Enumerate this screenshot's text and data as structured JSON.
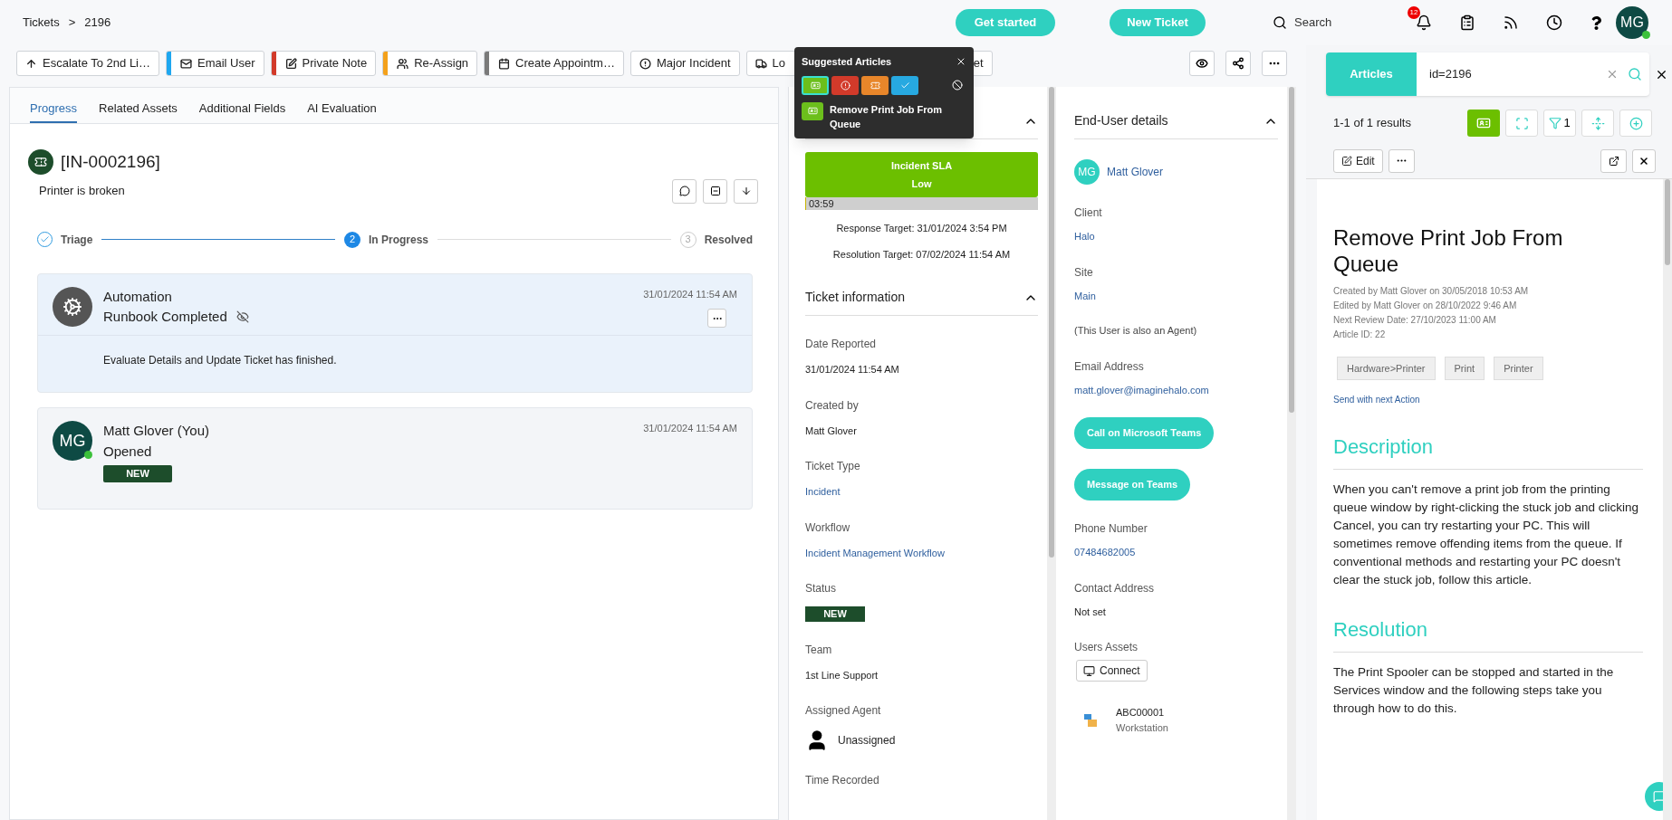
{
  "breadcrumb": {
    "items": [
      "Tickets",
      "2196"
    ],
    "separator": ">"
  },
  "header": {
    "buttons": [
      "Get started",
      "New Ticket"
    ],
    "search": {
      "placeholder": "Search"
    },
    "notification_count": "12",
    "avatar": {
      "initials": "MG",
      "online": true
    }
  },
  "toolbar": [
    {
      "label": "Escalate To 2nd Li…"
    },
    {
      "label": "Email User",
      "color": "#1ea7f0"
    },
    {
      "label": "Private Note",
      "color": "#d23a2a"
    },
    {
      "label": "Re-Assign",
      "color": "#f4a11b"
    },
    {
      "label": "Create Appointm…",
      "color": "#7a7a7a"
    },
    {
      "label": "Major Incident"
    },
    {
      "label": "Lo"
    },
    {
      "label": "et"
    }
  ],
  "suggested_articles": {
    "title": "Suggested Articles",
    "filters": [
      {
        "color": "#6cbf1c",
        "selected": true
      },
      {
        "color": "#d23a2a",
        "selected": false
      },
      {
        "color": "#e8862a",
        "selected": false
      },
      {
        "color": "#27a9e1",
        "selected": false
      }
    ],
    "articles": [
      {
        "title": "Remove Print Job From Queue"
      }
    ]
  },
  "tabs": [
    {
      "label": "Progress",
      "selected": true
    },
    {
      "label": "Related Assets",
      "selected": false
    },
    {
      "label": "Additional Fields",
      "selected": false
    },
    {
      "label": "AI Evaluation",
      "selected": false
    }
  ],
  "ticket": {
    "id": "[IN-0002196]",
    "summary": "Printer is broken"
  },
  "steps": [
    {
      "kind": "done",
      "label": "Triage"
    },
    {
      "kind": "current",
      "number": "2",
      "label": "In Progress"
    },
    {
      "kind": "pending",
      "number": "3",
      "label": "Resolved"
    }
  ],
  "actions": [
    {
      "kind": "automation",
      "author": "Automation",
      "title": "Runbook Completed",
      "hidden": true,
      "time": "31/01/2024 11:54 AM",
      "body": "Evaluate Details and Update Ticket has finished."
    },
    {
      "kind": "user",
      "initials": "MG",
      "online": true,
      "author": "Matt Glover (You)",
      "title": "Opened",
      "hidden": false,
      "time": "31/01/2024 11:54 AM",
      "badge": "NEW"
    }
  ],
  "sla": {
    "name": "Incident SLA",
    "priority": "Low",
    "timer": "03:59",
    "level": 0.005,
    "response_target": "Response Target: 31/01/2024 3:54 PM",
    "resolution_target": "Resolution Target: 07/02/2024 11:54 AM"
  },
  "ticket_info": {
    "title": "Ticket information",
    "fields": [
      {
        "kind": "text",
        "label": "Date Reported",
        "value": "31/01/2024 11:54 AM"
      },
      {
        "kind": "text",
        "label": "Created by",
        "value": "Matt Glover"
      },
      {
        "kind": "link",
        "label": "Ticket Type",
        "value": "Incident"
      },
      {
        "kind": "link",
        "label": "Workflow",
        "value": "Incident Management Workflow"
      },
      {
        "kind": "badge",
        "label": "Status",
        "value": "NEW"
      },
      {
        "kind": "text",
        "label": "Team",
        "value": "1st Line Support"
      },
      {
        "kind": "agent",
        "label": "Assigned Agent",
        "value": "Unassigned"
      },
      {
        "kind": "label",
        "label": "Time Recorded"
      }
    ]
  },
  "end_user": {
    "title": "End-User details",
    "items": [
      {
        "kind": "user",
        "initials": "MG",
        "name": "Matt Glover"
      },
      {
        "kind": "link",
        "label": "Client",
        "value": "Halo"
      },
      {
        "kind": "link",
        "label": "Site",
        "value": "Main"
      },
      {
        "kind": "note",
        "value": "(This User is also an Agent)"
      },
      {
        "kind": "link",
        "label": "Email Address",
        "value": "matt.glover@imaginehalo.com"
      },
      {
        "kind": "button",
        "value": "Call on Microsoft Teams"
      },
      {
        "kind": "button",
        "value": "Message on Teams"
      },
      {
        "kind": "link",
        "label": "Phone Number",
        "value": "07484682005"
      },
      {
        "kind": "text",
        "label": "Contact Address",
        "value": "Not set"
      },
      {
        "kind": "connect",
        "label": "Users Assets",
        "value": "Connect"
      },
      {
        "kind": "asset",
        "value": "ABC00001",
        "type": "Workstation"
      }
    ]
  },
  "articles_panel": {
    "tab": "Articles",
    "query": "id=2196",
    "results": "1-1 of 1 results",
    "filter_count": "1",
    "edit": "Edit",
    "article": {
      "title": "Remove Print Job From Queue",
      "meta": [
        "Created by Matt Glover on 30/05/2018 10:53 AM",
        "Edited by Matt Glover on 28/10/2022 9:46 AM",
        "Next Review Date: 27/10/2023 11:00 AM",
        "Article ID: 22"
      ],
      "tags": [
        "Hardware>Printer",
        "Print",
        "Printer"
      ],
      "send_link": "Send with next Action",
      "sections": [
        {
          "heading": "Description",
          "body": "When you can't remove a print job from the printing queue window by right-clicking the stuck job and clicking Cancel, you can try restarting your PC. This will sometimes remove offending items from the queue. If conventional methods and restarting your PC doesn't clear the stuck job, follow this article."
        },
        {
          "heading": "Resolution",
          "body": "The Print Spooler can be stopped and started in the Services window and the following steps take you through how to do this."
        }
      ]
    }
  }
}
